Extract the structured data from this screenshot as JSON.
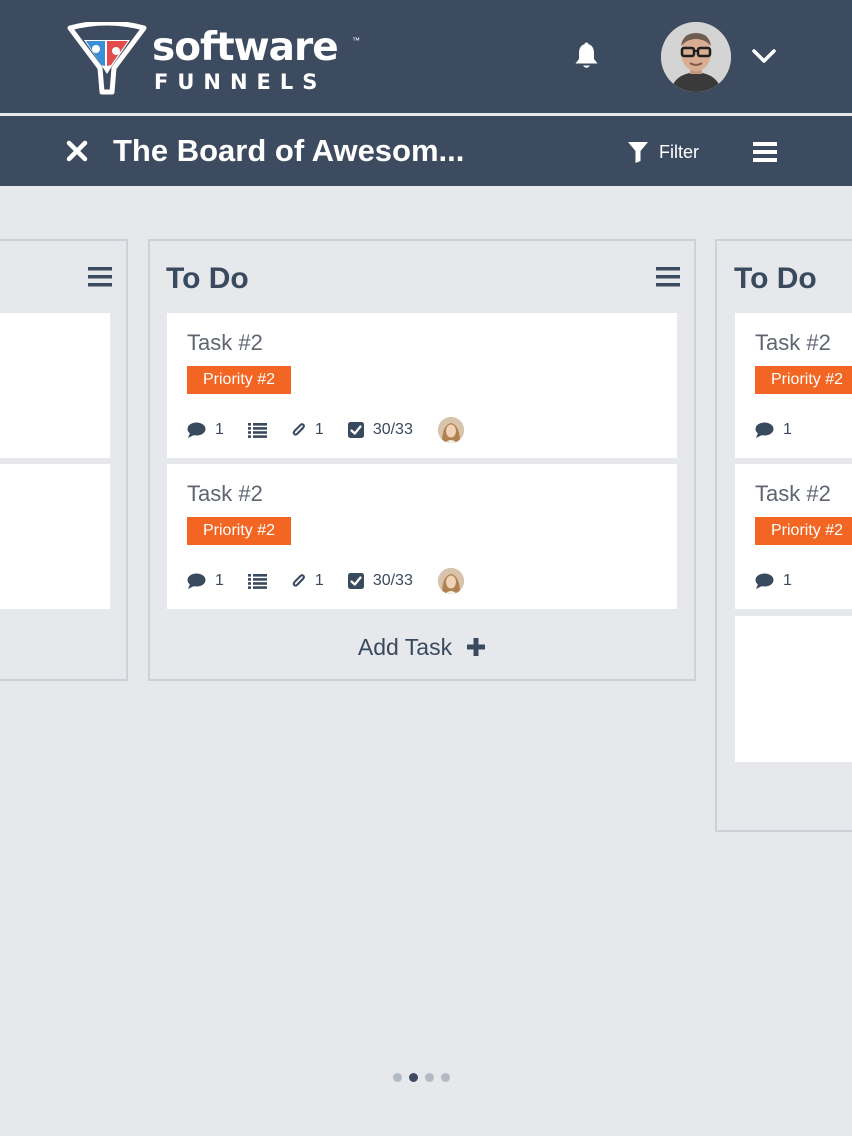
{
  "header": {
    "logo_word": "software",
    "logo_tm": "™",
    "logo_sub": "FUNNELS"
  },
  "subheader": {
    "board_title": "The Board of Awesom...",
    "filter_label": "Filter"
  },
  "colors": {
    "header_bg": "#3d4b60",
    "page_bg": "#e6e8ec",
    "priority_badge": "#f26522"
  },
  "columns": [
    {
      "title": "",
      "cards": [
        {},
        {}
      ]
    },
    {
      "title": "To Do",
      "cards": [
        {
          "title": "Task #2",
          "priority": "Priority #2",
          "comments": "1",
          "attachments": "1",
          "checklist": "30/33"
        },
        {
          "title": "Task #2",
          "priority": "Priority #2",
          "comments": "1",
          "attachments": "1",
          "checklist": "30/33"
        }
      ],
      "add_task_label": "Add Task"
    },
    {
      "title": "To Do",
      "cards": [
        {
          "title": "Task #2",
          "priority": "Priority #2",
          "comments": "1"
        },
        {
          "title": "Task #2",
          "priority": "Priority #2",
          "comments": "1"
        },
        {}
      ]
    }
  ],
  "pager": {
    "count": 4,
    "active_index": 1
  }
}
